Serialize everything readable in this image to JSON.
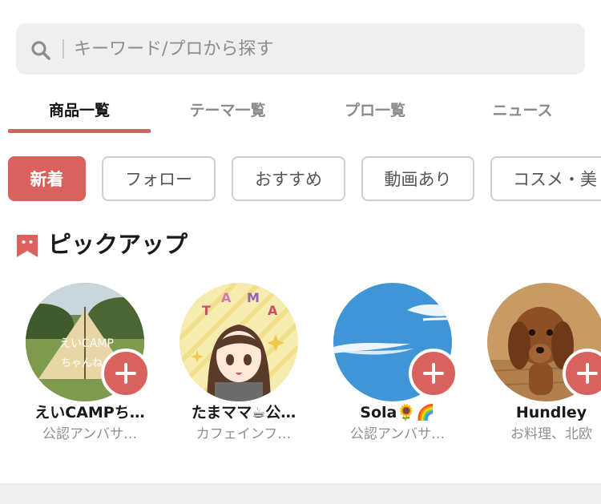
{
  "search": {
    "placeholder": "キーワード/プロから探す"
  },
  "tabs": [
    {
      "label": "商品一覧",
      "active": true
    },
    {
      "label": "テーマ一覧",
      "active": false
    },
    {
      "label": "プロ一覧",
      "active": false
    },
    {
      "label": "ニュース",
      "active": false
    }
  ],
  "chips": [
    {
      "label": "新着",
      "active": true
    },
    {
      "label": "フォロー",
      "active": false
    },
    {
      "label": "おすすめ",
      "active": false
    },
    {
      "label": "動画あり",
      "active": false
    },
    {
      "label": "コスメ・美",
      "active": false
    }
  ],
  "pickup": {
    "title": "ピックアップ",
    "icon": "bookmark-icon",
    "users": [
      {
        "name": "えいCAMPち…",
        "subtitle": "公認アンバサ…",
        "avatar_text": [
          "えいCAMP",
          "ちゃんね"
        ]
      },
      {
        "name": "たまママ☕公…",
        "subtitle": "カフェインフ…",
        "avatar_text": [
          "T",
          "A",
          "M",
          "A"
        ]
      },
      {
        "name": "Sola🌻🌈",
        "subtitle": "公認アンバサ…"
      },
      {
        "name": "Hundley",
        "subtitle": "お料理、北欧"
      }
    ]
  },
  "colors": {
    "accent": "#d9625f",
    "search_bg": "#efefef",
    "chip_border": "#cfcfcf",
    "muted_text": "#8f8f8f"
  }
}
